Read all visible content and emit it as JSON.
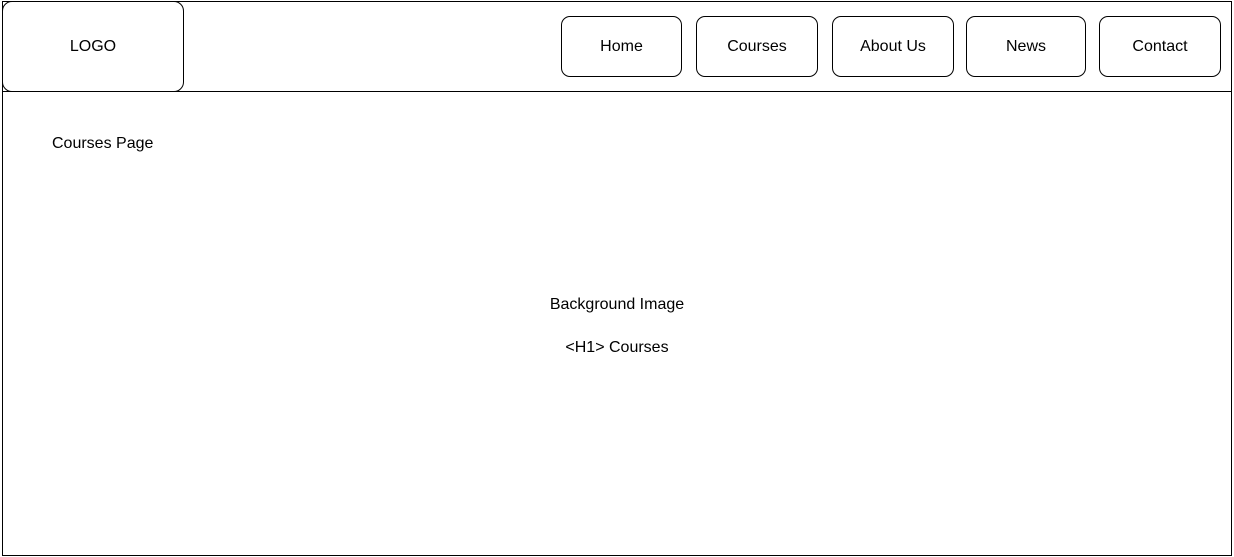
{
  "header": {
    "logo_text": "LOGO",
    "nav": {
      "home": "Home",
      "courses": "Courses",
      "about": "About Us",
      "news": "News",
      "contact": "Contact"
    }
  },
  "main": {
    "page_label": "Courses Page",
    "hero": {
      "background_label": "Background Image",
      "heading": "<H1> Courses"
    }
  },
  "colors": {
    "stroke": "#000000",
    "background": "#ffffff"
  }
}
